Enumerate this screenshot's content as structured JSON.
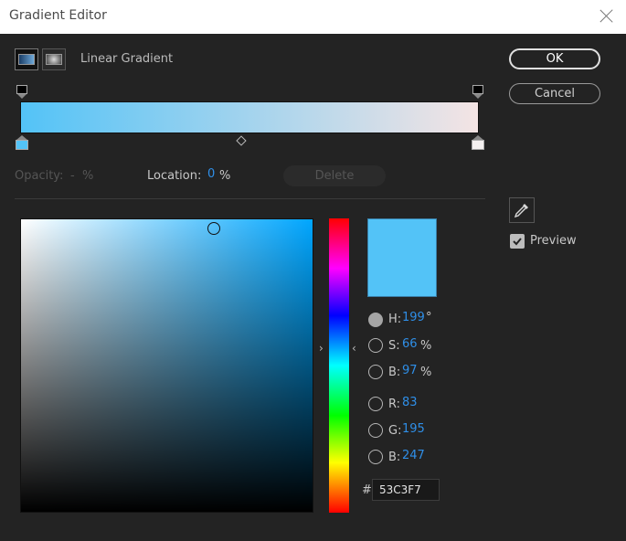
{
  "window": {
    "title": "Gradient Editor"
  },
  "gradient": {
    "type_label": "Linear Gradient",
    "start_color": "#53C3F7",
    "end_color": "#F4E4E4"
  },
  "buttons": {
    "ok": "OK",
    "cancel": "Cancel",
    "delete": "Delete"
  },
  "stop_controls": {
    "opacity_label": "Opacity:",
    "opacity_value": "-",
    "opacity_unit": "%",
    "location_label": "Location:",
    "location_value": "0",
    "location_unit": "%"
  },
  "color": {
    "hex_prefix": "#",
    "hex": "53C3F7",
    "h": {
      "label": "H:",
      "value": "199",
      "unit": "°"
    },
    "s": {
      "label": "S:",
      "value": "66",
      "unit": "%"
    },
    "b": {
      "label": "B:",
      "value": "97",
      "unit": "%"
    },
    "r": {
      "label": "R:",
      "value": "83"
    },
    "g": {
      "label": "G:",
      "value": "195"
    },
    "b2": {
      "label": "B:",
      "value": "247"
    }
  },
  "hue_arrows": {
    "left": "›",
    "right": "‹"
  },
  "preview": {
    "label": "Preview",
    "checked": true
  },
  "icons": [
    "close-icon",
    "linear-gradient-icon",
    "radial-gradient-icon",
    "eyedropper-icon",
    "checkmark-icon"
  ]
}
